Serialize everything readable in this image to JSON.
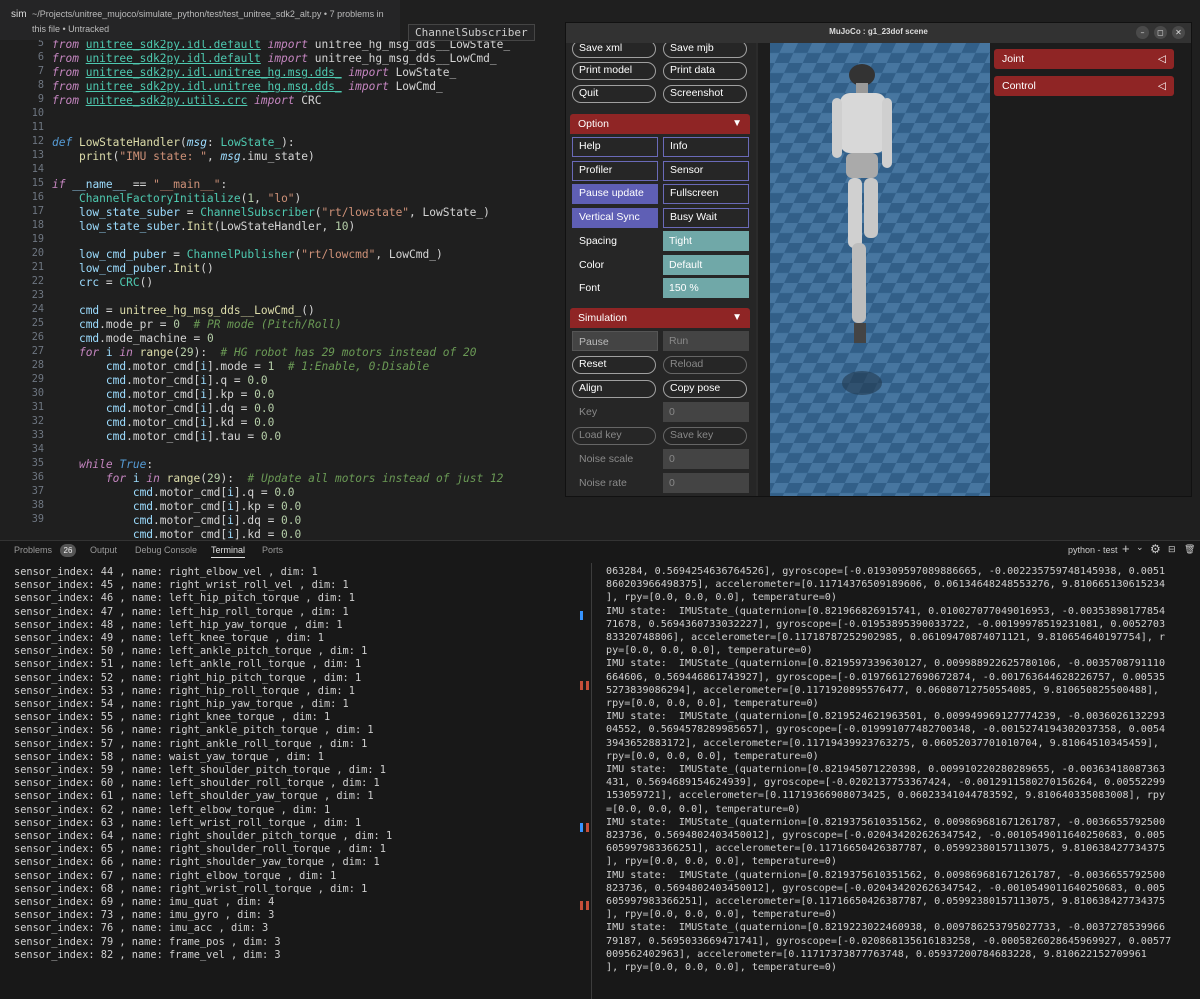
{
  "window": {
    "tab_label": "sim",
    "path_line1": "~/Projects/unitree_mujoco/simulate_python/test/test_unitree_sdk2_alt.py • 7 problems in",
    "path_line2": "this file • Untracked",
    "hover": "ChannelSubscriber"
  },
  "editor": {
    "line_numbers": [
      "5",
      "6",
      "7",
      "8",
      "9",
      "10",
      "11",
      "12",
      "13",
      "14",
      "15",
      "16",
      "17",
      "18",
      "19",
      "20",
      "21",
      "22",
      "23",
      "24",
      "25",
      "26",
      "27",
      "28",
      "29",
      "30",
      "31",
      "32",
      "33",
      "34",
      "35",
      "36",
      "37",
      "38",
      "39"
    ]
  },
  "mujoco": {
    "title": "MuJoCo : g1_23dof scene",
    "btn_close": "✕",
    "btn_max": "◻",
    "btn_min": "–",
    "file": {
      "save_xml": "Save xml",
      "save_mjb": "Save mjb",
      "print_model": "Print model",
      "print_data": "Print data",
      "quit": "Quit",
      "screenshot": "Screenshot"
    },
    "option": {
      "title": "Option",
      "help": "Help",
      "info": "Info",
      "profiler": "Profiler",
      "sensor": "Sensor",
      "pause_update": "Pause update",
      "fullscreen": "Fullscreen",
      "vertical_sync": "Vertical Sync",
      "busy_wait": "Busy Wait",
      "spacing_label": "Spacing",
      "spacing_value": "Tight",
      "color_label": "Color",
      "color_value": "Default",
      "font_label": "Font",
      "font_value": "150 %"
    },
    "simulation": {
      "title": "Simulation",
      "pause": "Pause",
      "run": "Run",
      "reset": "Reset",
      "reload": "Reload",
      "align": "Align",
      "copy_pose": "Copy pose",
      "key_label": "Key",
      "key_value": "0",
      "load_key": "Load key",
      "save_key": "Save key",
      "noise_scale_label": "Noise scale",
      "noise_scale_value": "0",
      "noise_rate_label": "Noise rate",
      "noise_rate_value": "0"
    },
    "right": {
      "joint": "Joint",
      "control": "Control"
    },
    "chevron": "◁",
    "chevron_down": "▼",
    "colors": {
      "section": "#8f2525",
      "toggle_on": "#5f5fb5",
      "value_box": "#70a8a8"
    }
  },
  "panel": {
    "tabs": {
      "problems": "Problems",
      "problems_count": "26",
      "output": "Output",
      "debug": "Debug Console",
      "terminal": "Terminal",
      "ports": "Ports"
    },
    "shell": "python - test",
    "add": "+",
    "chev": "⌄",
    "gear": "⚙",
    "trash": "🗑",
    "split": "⊟"
  },
  "terminal_left": [
    "sensor_index: 44 , name: right_elbow_vel , dim: 1",
    "sensor_index: 45 , name: right_wrist_roll_vel , dim: 1",
    "sensor_index: 46 , name: left_hip_pitch_torque , dim: 1",
    "sensor_index: 47 , name: left_hip_roll_torque , dim: 1",
    "sensor_index: 48 , name: left_hip_yaw_torque , dim: 1",
    "sensor_index: 49 , name: left_knee_torque , dim: 1",
    "sensor_index: 50 , name: left_ankle_pitch_torque , dim: 1",
    "sensor_index: 51 , name: left_ankle_roll_torque , dim: 1",
    "sensor_index: 52 , name: right_hip_pitch_torque , dim: 1",
    "sensor_index: 53 , name: right_hip_roll_torque , dim: 1",
    "sensor_index: 54 , name: right_hip_yaw_torque , dim: 1",
    "sensor_index: 55 , name: right_knee_torque , dim: 1",
    "sensor_index: 56 , name: right_ankle_pitch_torque , dim: 1",
    "sensor_index: 57 , name: right_ankle_roll_torque , dim: 1",
    "sensor_index: 58 , name: waist_yaw_torque , dim: 1",
    "sensor_index: 59 , name: left_shoulder_pitch_torque , dim: 1",
    "sensor_index: 60 , name: left_shoulder_roll_torque , dim: 1",
    "sensor_index: 61 , name: left_shoulder_yaw_torque , dim: 1",
    "sensor_index: 62 , name: left_elbow_torque , dim: 1",
    "sensor_index: 63 , name: left_wrist_roll_torque , dim: 1",
    "sensor_index: 64 , name: right_shoulder_pitch_torque , dim: 1",
    "sensor_index: 65 , name: right_shoulder_roll_torque , dim: 1",
    "sensor_index: 66 , name: right_shoulder_yaw_torque , dim: 1",
    "sensor_index: 67 , name: right_elbow_torque , dim: 1",
    "sensor_index: 68 , name: right_wrist_roll_torque , dim: 1",
    "sensor_index: 69 , name: imu_quat , dim: 4",
    "sensor_index: 73 , name: imu_gyro , dim: 3",
    "sensor_index: 76 , name: imu_acc , dim: 3",
    "sensor_index: 79 , name: frame_pos , dim: 3",
    "sensor_index: 82 , name: frame_vel , dim: 3"
  ],
  "terminal_right": [
    "063284, 0.5694254636764526], gyroscope=[-0.019309597089886665, -0.002235759748145938, 0.0051",
    "860203966498375], accelerometer=[0.11714376509189606, 0.06134648248553276, 9.810665130615234",
    "], rpy=[0.0, 0.0, 0.0], temperature=0)",
    "IMU state:  IMUState_(quaternion=[0.821966826915741, 0.010027077049016953, -0.00353898177854",
    "71678, 0.5694360733032227], gyroscope=[-0.01953895390033722, -0.00199978519231081, 0.0052703",
    "83320748806], accelerometer=[0.11718787252902985, 0.06109470874071121, 9.810654640197754], r",
    "py=[0.0, 0.0, 0.0], temperature=0)",
    "IMU state:  IMUState_(quaternion=[0.8219597339630127, 0.009988922625780106, -0.0035708791110",
    "664606, 0.569446861743927], gyroscope=[-0.019766127690672874, -0.001763644628226757, 0.00535",
    "5273839086294], accelerometer=[0.1171920895576477, 0.06080712750554085, 9.810650825500488],",
    "rpy=[0.0, 0.0, 0.0], temperature=0)",
    "IMU state:  IMUState_(quaternion=[0.8219524621963501, 0.009949969127774239, -0.0036026132293",
    "04552, 0.5694578289985657], gyroscope=[-0.019991077482700348, -0.0015274194302037358, 0.0054",
    "3943652883172], accelerometer=[0.11719439923763275, 0.06052037701010704, 9.81064510345459],",
    "rpy=[0.0, 0.0, 0.0], temperature=0)",
    "IMU state:  IMUState_(quaternion=[0.821945071220398, 0.009910220280289655, -0.00363418087363",
    "431, 0.5694689154624939], gyroscope=[-0.0202137753367424, -0.0012911580270156264, 0.00552299",
    "153059721], accelerometer=[0.11719366908073425, 0.06023341044783592, 9.810640335083008], rpy",
    "=[0.0, 0.0, 0.0], temperature=0)",
    "IMU state:  IMUState_(quaternion=[0.8219375610351562, 0.009869681671261787, -0.0036655792500",
    "823736, 0.5694802403450012], gyroscope=[-0.020434202626347542, -0.0010549011640250683, 0.005",
    "605997983366251], accelerometer=[0.11716650426387787, 0.05992380157113075, 9.810638427734375",
    "], rpy=[0.0, 0.0, 0.0], temperature=0)",
    "IMU state:  IMUState_(quaternion=[0.8219375610351562, 0.009869681671261787, -0.0036655792500",
    "823736, 0.5694802403450012], gyroscope=[-0.020434202626347542, -0.0010549011640250683, 0.005",
    "605997983366251], accelerometer=[0.11716650426387787, 0.05992380157113075, 9.810638427734375",
    "], rpy=[0.0, 0.0, 0.0], temperature=0)",
    "IMU state:  IMUState_(quaternion=[0.8219223022460938, 0.009786253795027733, -0.0037278539966",
    "79187, 0.5695033669471741], gyroscope=[-0.020868135616183258, -0.0005826028645969927, 0.00577",
    "009562402963], accelerometer=[0.11717373877763748, 0.05937200784683228, 9.810622152709961",
    "], rpy=[0.0, 0.0, 0.0], temperature=0)"
  ]
}
